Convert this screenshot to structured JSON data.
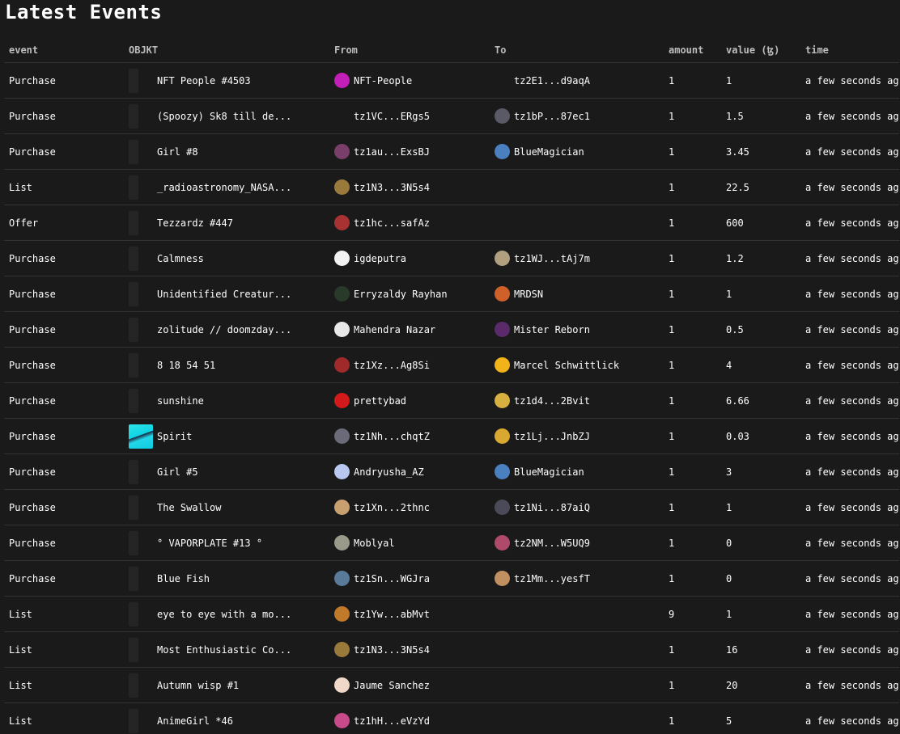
{
  "page": {
    "title": "Latest Events"
  },
  "columns": [
    "event",
    "OBJKT",
    "From",
    "To",
    "amount",
    "value (ꜩ)",
    "time"
  ],
  "rows": [
    {
      "event": "Purchase",
      "objkt": "NFT People #4503",
      "thumb": "placeholder",
      "from": "NFT-People",
      "from_avatar": "#c21fb8",
      "to": "tz2E1...d9aqA",
      "to_avatar": "none",
      "amount": "1",
      "value": "1",
      "time": "a few seconds ago"
    },
    {
      "event": "Purchase",
      "objkt": "(Spoozy) Sk8 till de...",
      "thumb": "placeholder",
      "from": "tz1VC...ERgs5",
      "from_avatar": "none",
      "to": "tz1bP...87ec1",
      "to_avatar": "#5a5a66",
      "amount": "1",
      "value": "1.5",
      "time": "a few seconds ago"
    },
    {
      "event": "Purchase",
      "objkt": "Girl #8",
      "thumb": "placeholder",
      "from": "tz1au...ExsBJ",
      "from_avatar": "#7a3e6a",
      "to": "BlueMagician",
      "to_avatar": "#4a7fc0",
      "amount": "1",
      "value": "3.45",
      "time": "a few seconds ago"
    },
    {
      "event": "List",
      "objkt": "_radioastronomy_NASA...",
      "thumb": "placeholder",
      "from": "tz1N3...3N5s4",
      "from_avatar": "#9a7a3a",
      "to": "",
      "to_avatar": "none",
      "amount": "1",
      "value": "22.5",
      "time": "a few seconds ago"
    },
    {
      "event": "Offer",
      "objkt": "Tezzardz #447",
      "thumb": "placeholder",
      "from": "tz1hc...safAz",
      "from_avatar": "#a83232",
      "to": "",
      "to_avatar": "none",
      "amount": "1",
      "value": "600",
      "time": "a few seconds ago"
    },
    {
      "event": "Purchase",
      "objkt": "Calmness",
      "thumb": "placeholder",
      "from": "igdeputra",
      "from_avatar": "#f2f2f2",
      "to": "tz1WJ...tAj7m",
      "to_avatar": "#b0a080",
      "amount": "1",
      "value": "1.2",
      "time": "a few seconds ago"
    },
    {
      "event": "Purchase",
      "objkt": "Unidentified Creatur...",
      "thumb": "placeholder",
      "from": "Erryzaldy Rayhan",
      "from_avatar": "#2a3a2a",
      "to": "MRDSN",
      "to_avatar": "#d0602a",
      "amount": "1",
      "value": "1",
      "time": "a few seconds ago"
    },
    {
      "event": "Purchase",
      "objkt": "zolitude // doomzday...",
      "thumb": "placeholder",
      "from": "Mahendra Nazar",
      "from_avatar": "#e8e8e8",
      "to": "Mister Reborn",
      "to_avatar": "#5a2a6a",
      "amount": "1",
      "value": "0.5",
      "time": "a few seconds ago"
    },
    {
      "event": "Purchase",
      "objkt": "8 18 54 51",
      "thumb": "placeholder",
      "from": "tz1Xz...Ag8Si",
      "from_avatar": "#a02a2a",
      "to": "Marcel Schwittlick",
      "to_avatar": "#f2b21a",
      "amount": "1",
      "value": "4",
      "time": "a few seconds ago"
    },
    {
      "event": "Purchase",
      "objkt": "sunshine",
      "thumb": "placeholder",
      "from": "prettybad",
      "from_avatar": "#d21a1a",
      "to": "tz1d4...2Bvit",
      "to_avatar": "#d8b040",
      "amount": "1",
      "value": "6.66",
      "time": "a few seconds ago"
    },
    {
      "event": "Purchase",
      "objkt": "Spirit",
      "thumb": "spirit",
      "from": "tz1Nh...chqtZ",
      "from_avatar": "#6a6a78",
      "to": "tz1Lj...JnbZJ",
      "to_avatar": "#d8a830",
      "amount": "1",
      "value": "0.03",
      "time": "a few seconds ago"
    },
    {
      "event": "Purchase",
      "objkt": "Girl #5",
      "thumb": "placeholder",
      "from": "Andryusha_AZ",
      "from_avatar": "#b8c8f0",
      "to": "BlueMagician",
      "to_avatar": "#4a7fc0",
      "amount": "1",
      "value": "3",
      "time": "a few seconds ago"
    },
    {
      "event": "Purchase",
      "objkt": "The Swallow",
      "thumb": "placeholder",
      "from": "tz1Xn...2thnc",
      "from_avatar": "#c8a070",
      "to": "tz1Ni...87aiQ",
      "to_avatar": "#4a4a58",
      "amount": "1",
      "value": "1",
      "time": "a few seconds ago"
    },
    {
      "event": "Purchase",
      "objkt": "° VAPORPLATE #13 °",
      "thumb": "placeholder",
      "from": "Moblyal",
      "from_avatar": "#9a9a8a",
      "to": "tz2NM...W5UQ9",
      "to_avatar": "#b04a6a",
      "amount": "1",
      "value": "0",
      "time": "a few seconds ago"
    },
    {
      "event": "Purchase",
      "objkt": "Blue Fish",
      "thumb": "placeholder",
      "from": "tz1Sn...WGJra",
      "from_avatar": "#5a7a9a",
      "to": "tz1Mm...yesfT",
      "to_avatar": "#c09060",
      "amount": "1",
      "value": "0",
      "time": "a few seconds ago"
    },
    {
      "event": "List",
      "objkt": "eye to eye with a mo...",
      "thumb": "placeholder",
      "from": "tz1Yw...abMvt",
      "from_avatar": "#c07a2a",
      "to": "",
      "to_avatar": "none",
      "amount": "9",
      "value": "1",
      "time": "a few seconds ago"
    },
    {
      "event": "List",
      "objkt": "Most Enthusiastic Co...",
      "thumb": "placeholder",
      "from": "tz1N3...3N5s4",
      "from_avatar": "#9a7a3a",
      "to": "",
      "to_avatar": "none",
      "amount": "1",
      "value": "16",
      "time": "a few seconds ago"
    },
    {
      "event": "List",
      "objkt": "Autumn wisp #1",
      "thumb": "placeholder",
      "from": "Jaume Sanchez",
      "from_avatar": "#f0d8c8",
      "to": "",
      "to_avatar": "none",
      "amount": "1",
      "value": "20",
      "time": "a few seconds ago"
    },
    {
      "event": "List",
      "objkt": "AnimeGirl *46",
      "thumb": "placeholder",
      "from": "tz1hH...eVzYd",
      "from_avatar": "#c84a8a",
      "to": "",
      "to_avatar": "none",
      "amount": "1",
      "value": "5",
      "time": "a few seconds ago"
    }
  ]
}
